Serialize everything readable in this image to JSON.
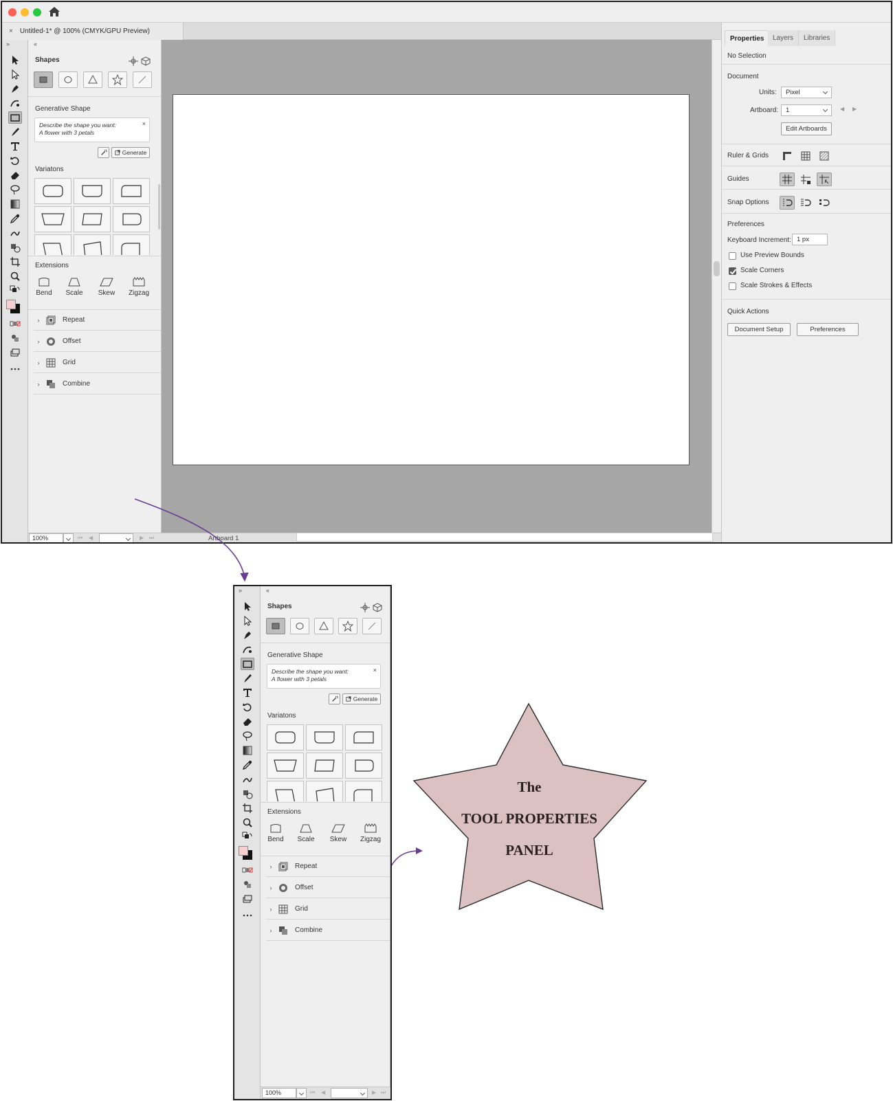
{
  "window": {
    "document_tab": "Untitled-1* @ 100% (CMYK/GPU Preview)",
    "close_glyph": "×",
    "traffic_colors": {
      "close": "#fe5f57",
      "minimize": "#febc2e",
      "zoom": "#28c840"
    }
  },
  "tool_panel": {
    "shapes_label": "Shapes",
    "shape_types": [
      "rectangle",
      "ellipse",
      "triangle",
      "star",
      "line"
    ],
    "generative_shape_label": "Generative Shape",
    "prompt_placeholder": "Describe the shape you want:",
    "prompt_value": "A flower with 3 petals",
    "prompt_close": "×",
    "generate_label": "Generate",
    "variations_label": "Variatons",
    "extensions_label": "Extensions",
    "extensions": [
      "Bend",
      "Scale",
      "Skew",
      "Zigzag"
    ],
    "rows": [
      "Repeat",
      "Offset",
      "Grid",
      "Combine"
    ],
    "collapse_glyph": "«",
    "expand_glyph": "»"
  },
  "status_bar": {
    "zoom": "100%",
    "artboard_name": "Artboard 1"
  },
  "properties_panel": {
    "tabs": [
      "Properties",
      "Layers",
      "Libraries"
    ],
    "selection_status": "No Selection",
    "document_label": "Document",
    "units_label": "Units:",
    "units_value": "Pixel",
    "artboard_label": "Artboard:",
    "artboard_value": "1",
    "edit_artboards_label": "Edit Artboards",
    "ruler_grids_label": "Ruler & Grids",
    "guides_label": "Guides",
    "snap_options_label": "Snap Options",
    "preferences_label": "Preferences",
    "keyboard_increment_label": "Keyboard Increment:",
    "keyboard_increment_value": "1 px",
    "checkboxes": [
      {
        "label": "Use Preview Bounds",
        "checked": false
      },
      {
        "label": "Scale Corners",
        "checked": true
      },
      {
        "label": "Scale Strokes & Effects",
        "checked": false
      }
    ],
    "quick_actions_label": "Quick Actions",
    "document_setup_label": "Document Setup",
    "preferences_button_label": "Preferences"
  },
  "callout": {
    "line1": "The",
    "line2": "TOOL PROPERTIES",
    "line3": "PANEL",
    "star_fill": "#dcc1c2",
    "arrow_color": "#6a3d8f"
  }
}
